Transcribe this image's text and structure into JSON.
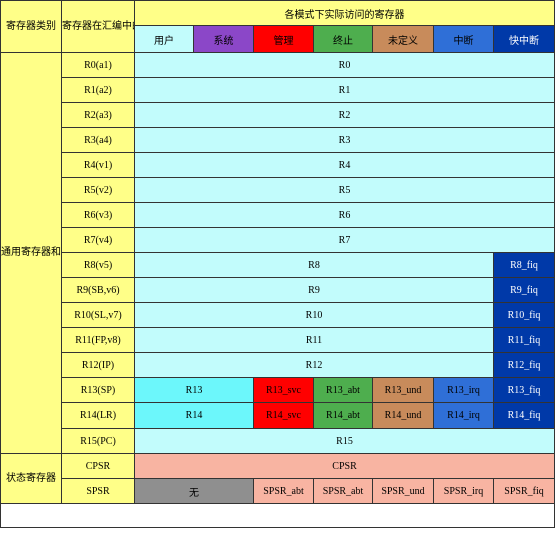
{
  "header": {
    "category": "寄存器类别",
    "asm_name": "寄存器在汇编中的名称",
    "modes_title": "各模式下实际访问的寄存器",
    "modes": [
      "用户",
      "系统",
      "管理",
      "终止",
      "未定义",
      "中断",
      "快中断"
    ]
  },
  "categories": {
    "general": "通用寄存器和程序计数器",
    "status": "状态寄存器"
  },
  "registers": {
    "r0": {
      "name": "R0(a1)",
      "all": "R0"
    },
    "r1": {
      "name": "R1(a2)",
      "all": "R1"
    },
    "r2": {
      "name": "R2(a3)",
      "all": "R2"
    },
    "r3": {
      "name": "R3(a4)",
      "all": "R3"
    },
    "r4": {
      "name": "R4(v1)",
      "all": "R4"
    },
    "r5": {
      "name": "R5(v2)",
      "all": "R5"
    },
    "r6": {
      "name": "R6(v3)",
      "all": "R6"
    },
    "r7": {
      "name": "R7(v4)",
      "all": "R7"
    },
    "r8": {
      "name": "R8(v5)",
      "common": "R8",
      "fiq": "R8_fiq"
    },
    "r9": {
      "name": "R9(SB,v6)",
      "common": "R9",
      "fiq": "R9_fiq"
    },
    "r10": {
      "name": "R10(SL,v7)",
      "common": "R10",
      "fiq": "R10_fiq"
    },
    "r11": {
      "name": "R11(FP,v8)",
      "common": "R11",
      "fiq": "R11_fiq"
    },
    "r12": {
      "name": "R12(IP)",
      "common": "R12",
      "fiq": "R12_fiq"
    },
    "r13": {
      "name": "R13(SP)",
      "usr": "R13",
      "svc": "R13_svc",
      "abt": "R13_abt",
      "und": "R13_und",
      "irq": "R13_irq",
      "fiq": "R13_fiq"
    },
    "r14": {
      "name": "R14(LR)",
      "usr": "R14",
      "svc": "R14_svc",
      "abt": "R14_abt",
      "und": "R14_und",
      "irq": "R14_irq",
      "fiq": "R14_fiq"
    },
    "r15": {
      "name": "R15(PC)",
      "all": "R15"
    }
  },
  "status": {
    "cpsr": {
      "name": "CPSR",
      "all": "CPSR"
    },
    "spsr": {
      "name": "SPSR",
      "none": "无",
      "svc": "SPSR_abt",
      "abt": "SPSR_abt",
      "und": "SPSR_und",
      "irq": "SPSR_irq",
      "fiq": "SPSR_fiq"
    }
  },
  "colors": {
    "category_bg": "#ffff88",
    "common_bg": "#c2fcfc",
    "user_bg": "#6cf7fb",
    "system_bg": "#8b47c8",
    "svc_bg": "#ff0000",
    "abt_bg": "#4eae4e",
    "und_bg": "#c88b5b",
    "irq_bg": "#2f6fd7",
    "fiq_bg": "#0039a8",
    "status_bg": "#f8b4a2",
    "none_bg": "#8f8f8f"
  }
}
